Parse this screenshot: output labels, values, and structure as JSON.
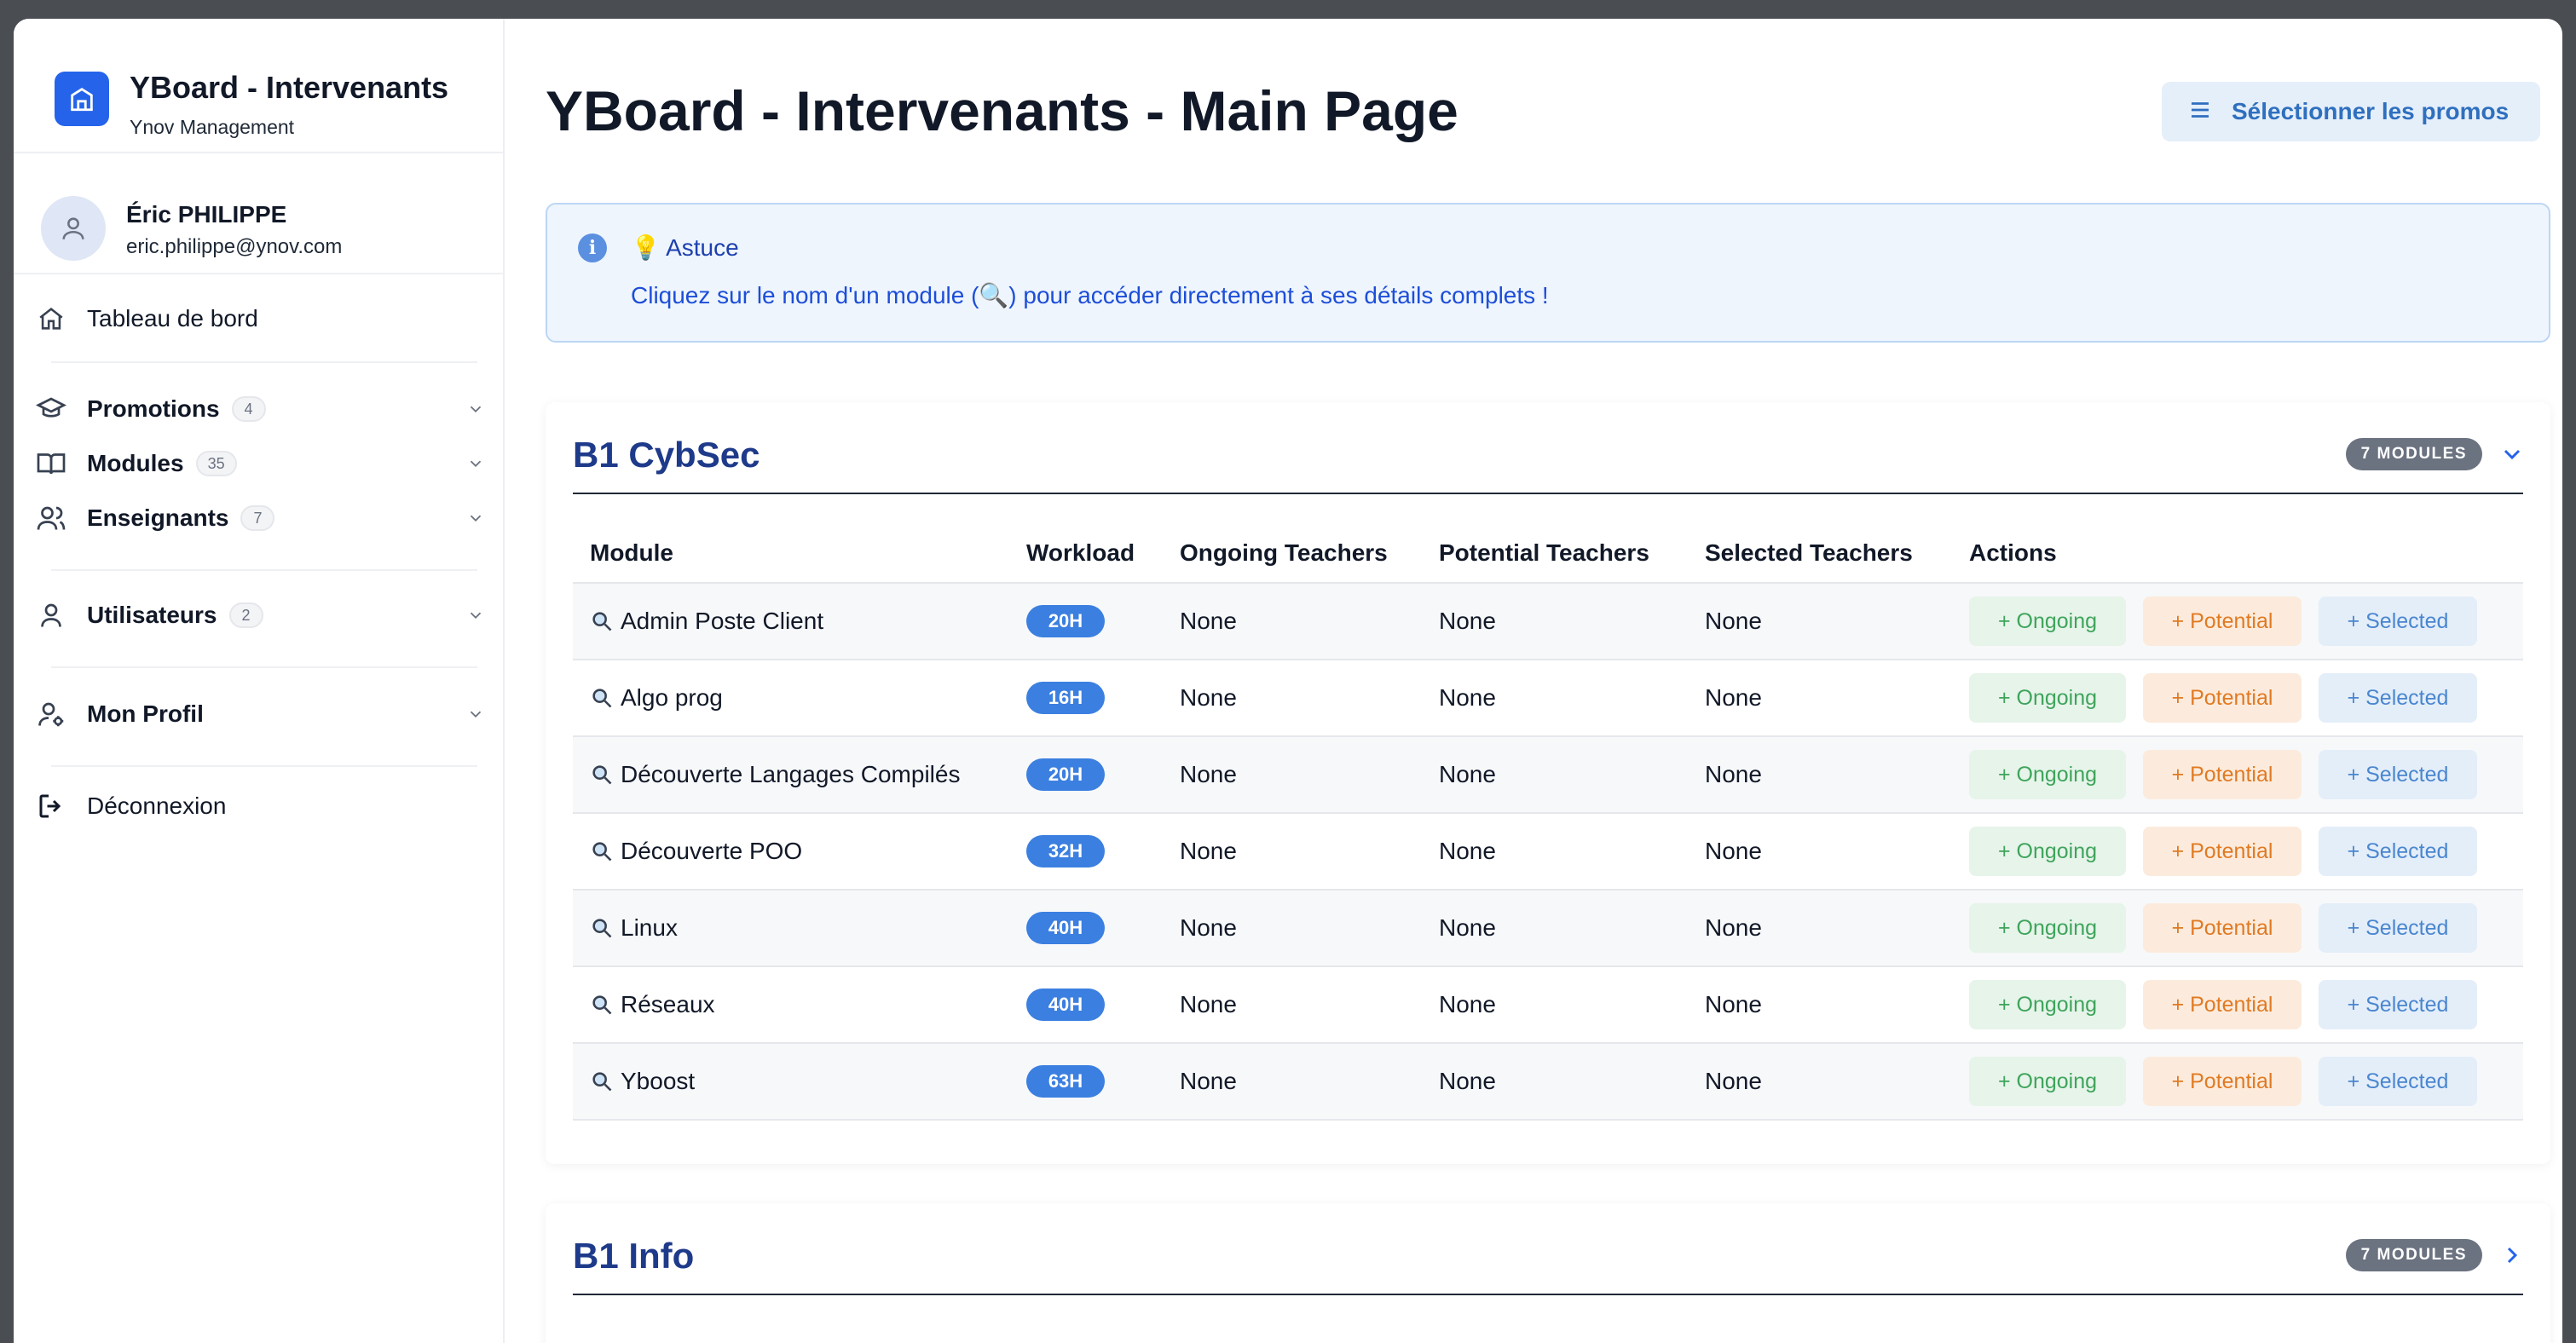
{
  "sidebar": {
    "brand_title": "YBoard - Intervenants",
    "brand_subtitle": "Ynov Management",
    "user_name": "Éric PHILIPPE",
    "user_email": "eric.philippe@ynov.com",
    "items": [
      {
        "label": "Tableau de bord",
        "icon": "home-icon"
      },
      {
        "label": "Promotions",
        "badge": "4",
        "icon": "graduation-cap-icon"
      },
      {
        "label": "Modules",
        "badge": "35",
        "icon": "book-icon"
      },
      {
        "label": "Enseignants",
        "badge": "7",
        "icon": "users-icon"
      },
      {
        "label": "Utilisateurs",
        "badge": "2",
        "icon": "user-icon"
      },
      {
        "label": "Mon Profil",
        "icon": "user-settings-icon"
      },
      {
        "label": "Déconnexion",
        "icon": "logout-icon"
      }
    ]
  },
  "header": {
    "title": "YBoard - Intervenants - Main Page",
    "promo_button": "Sélectionner les promos"
  },
  "tip": {
    "title": "💡 Astuce",
    "text": "Cliquez sur le nom d'un module (🔍) pour accéder directement à ses détails complets !"
  },
  "table_headers": [
    "Module",
    "Workload",
    "Ongoing Teachers",
    "Potential Teachers",
    "Selected Teachers",
    "Actions"
  ],
  "actions": {
    "ongoing": "+ Ongoing",
    "potential": "+ Potential",
    "selected": "+ Selected"
  },
  "sections": [
    {
      "title": "B1 CybSec",
      "badge": "7 MODULES",
      "expanded": true,
      "rows": [
        {
          "module": "Admin Poste Client",
          "workload": "20H",
          "ongoing": "None",
          "potential": "None",
          "selected": "None"
        },
        {
          "module": "Algo prog",
          "workload": "16H",
          "ongoing": "None",
          "potential": "None",
          "selected": "None"
        },
        {
          "module": "Découverte Langages Compilés",
          "workload": "20H",
          "ongoing": "None",
          "potential": "None",
          "selected": "None"
        },
        {
          "module": "Découverte POO",
          "workload": "32H",
          "ongoing": "None",
          "potential": "None",
          "selected": "None"
        },
        {
          "module": "Linux",
          "workload": "40H",
          "ongoing": "None",
          "potential": "None",
          "selected": "None"
        },
        {
          "module": "Réseaux",
          "workload": "40H",
          "ongoing": "None",
          "potential": "None",
          "selected": "None"
        },
        {
          "module": "Yboost",
          "workload": "63H",
          "ongoing": "None",
          "potential": "None",
          "selected": "None"
        }
      ]
    },
    {
      "title": "B1 Info",
      "badge": "7 MODULES",
      "expanded": false
    }
  ],
  "colors": {
    "accent": "#2563eb",
    "section_title": "#1e3a8a",
    "ongoing": "#3fa45b",
    "potential": "#e07a23",
    "selected": "#4a86cf"
  }
}
